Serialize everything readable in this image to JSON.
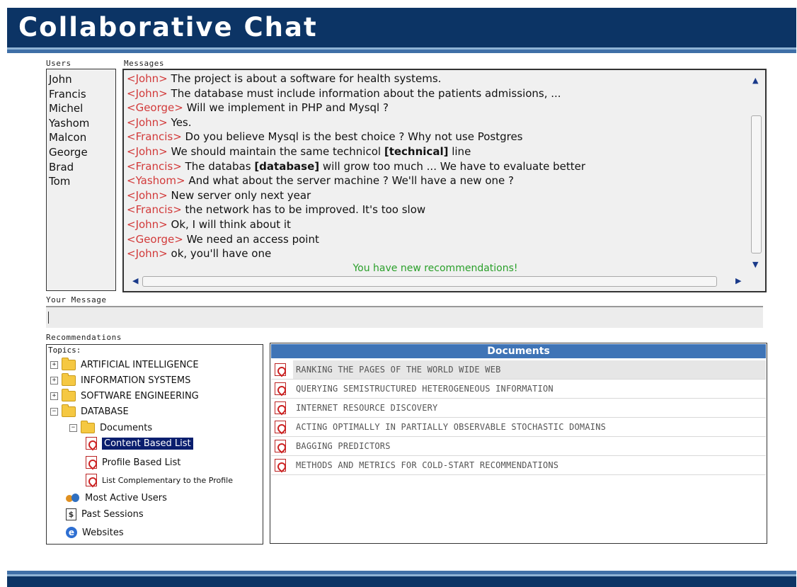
{
  "header": {
    "title": "Collaborative Chat"
  },
  "labels": {
    "users": "Users",
    "messages": "Messages",
    "your_message": "Your Message",
    "recommendations": "Recommendations",
    "topics": "Topics:",
    "documents": "Documents"
  },
  "users": [
    "John",
    "Francis",
    "Michel",
    "Yashom",
    "Malcon",
    "George",
    "Brad",
    "Tom"
  ],
  "messages": [
    {
      "author": "<John>",
      "text": " The project is about a software for health systems."
    },
    {
      "author": "<John>",
      "text": " The database must include information about the patients admissions, ..."
    },
    {
      "author": "<George>",
      "text": " Will we implement in PHP and Mysql ?"
    },
    {
      "author": "<John>",
      "text": " Yes."
    },
    {
      "author": "<Francis>",
      "text": " Do you believe Mysql is the best choice ? Why not use Postgres"
    },
    {
      "author": "<John>",
      "text": " We should maintain the same technicol ",
      "correction": "[technical]",
      "after": " line"
    },
    {
      "author": "<Francis>",
      "text": " The databas ",
      "correction": "[database]",
      "after": " will grow too much ... We have to evaluate better"
    },
    {
      "author": "<Yashom>",
      "text": " And what about the server machine ? We'll have a new one ?"
    },
    {
      "author": "<John>",
      "text": " New server only next year"
    },
    {
      "author": "<Francis>",
      "text": " the network has to be improved. It's too slow"
    },
    {
      "author": "<John>",
      "text": " Ok, I will think about it"
    },
    {
      "author": "<George>",
      "text": " We need an access point"
    },
    {
      "author": "<John>",
      "text": " ok, you'll have one"
    }
  ],
  "notice": "You have new recommendations!",
  "input": {
    "value": ""
  },
  "topics_tree": {
    "t1": "ARTIFICIAL INTELLIGENCE",
    "t2": "INFORMATION SYSTEMS",
    "t3": "SOFTWARE ENGINEERING",
    "t4": "DATABASE",
    "documents": "Documents",
    "content": "Content Based List",
    "profile": "Profile Based List",
    "complementary": "List Complementary to the Profile",
    "active_users": "Most Active Users",
    "past_sessions": "Past Sessions",
    "websites": "Websites"
  },
  "documents": [
    "RANKING THE PAGES OF THE WORLD WIDE WEB",
    "QUERYING SEMISTRUCTURED HETEROGENEOUS INFORMATION",
    "INTERNET RESOURCE DISCOVERY",
    "ACTING OPTIMALLY IN PARTIALLY OBSERVABLE STOCHASTIC DOMAINS",
    "BAGGING PREDICTORS",
    "METHODS AND METRICS FOR COLD-START RECOMMENDATIONS"
  ],
  "icons": {
    "expand": "plus-box-icon",
    "collapse": "minus-box-icon",
    "folder": "folder-icon",
    "pdf": "pdf-icon",
    "users": "users-icon",
    "sessions": "sessions-icon",
    "web": "internet-explorer-icon"
  },
  "colors": {
    "header": "#0c3465",
    "author": "#d23a3a",
    "notice": "#2aa02a",
    "docs_header": "#3f74b6",
    "selection": "#0a1e6e"
  }
}
